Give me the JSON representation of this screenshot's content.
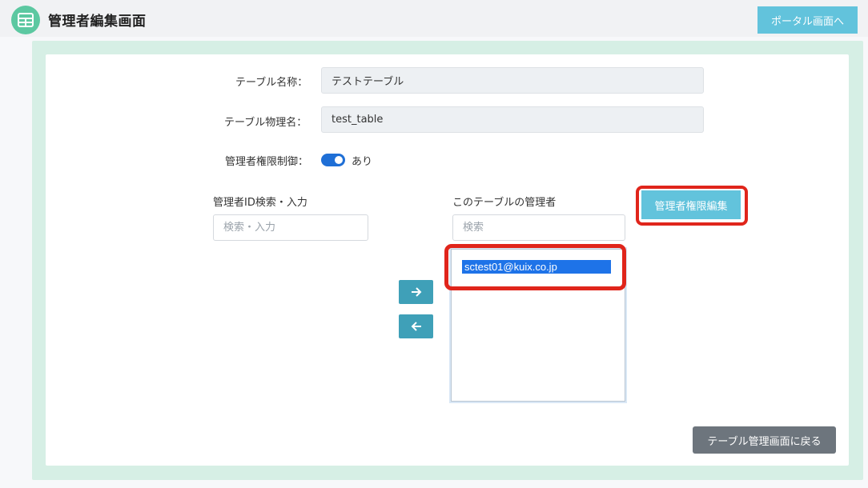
{
  "header": {
    "title": "管理者編集画面",
    "icon": "table-icon",
    "portal_button": "ポータル画面へ"
  },
  "form": {
    "table_name_label": "テーブル名称：",
    "table_name_value": "テストテーブル",
    "table_physical_label": "テーブル物理名：",
    "table_physical_value": "test_table",
    "admin_control_label": "管理者権限制御：",
    "admin_control_value": "あり",
    "admin_control_on": true
  },
  "left_panel": {
    "label": "管理者ID検索・入力",
    "placeholder": "検索・入力"
  },
  "right_panel": {
    "label": "このテーブルの管理者",
    "placeholder": "検索",
    "edit_button": "管理者権限編集",
    "items": [
      "sctest01@kuix.co.jp"
    ]
  },
  "footer": {
    "back_button": "テーブル管理画面に戻る"
  },
  "colors": {
    "accent": "#62c3dc",
    "selection": "#1e73e8",
    "highlight": "#e0251b",
    "toggle": "#1f6fd6"
  }
}
